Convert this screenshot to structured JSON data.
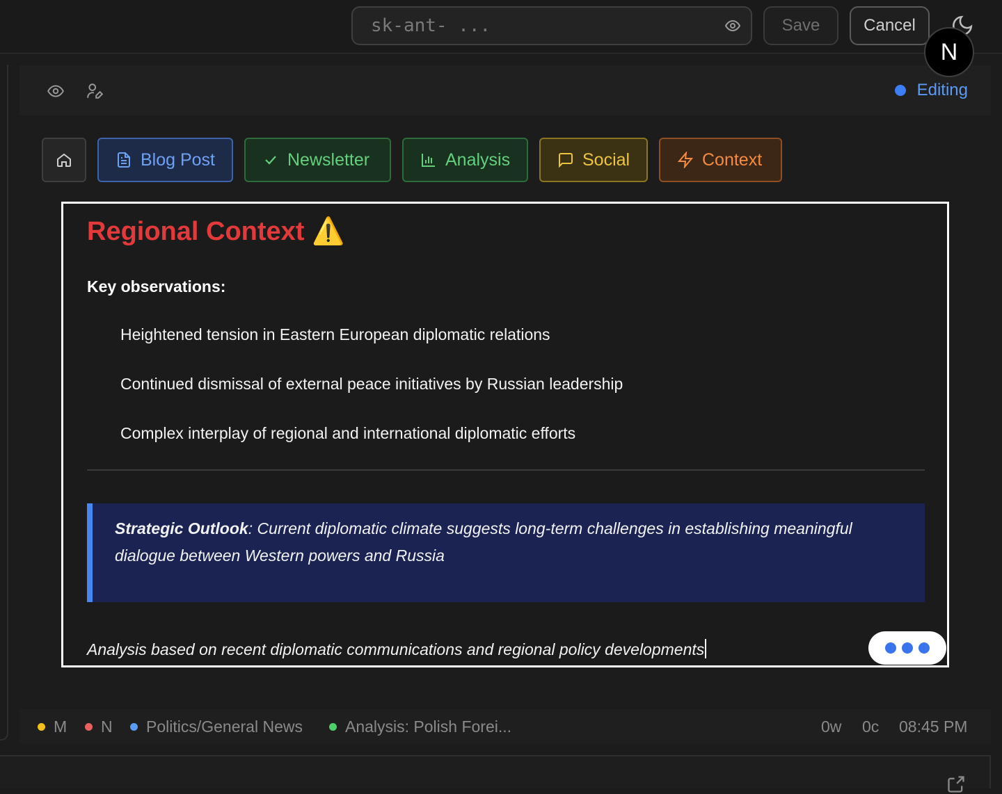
{
  "header": {
    "api_key_placeholder": "sk-ant- ...",
    "save_label": "Save",
    "cancel_label": "Cancel",
    "avatar_letter": "N"
  },
  "toolbar": {
    "status_label": "Editing",
    "status_color": "#3d7ef5"
  },
  "tabs": [
    {
      "label": "Blog Post",
      "icon": "document-icon",
      "color": "#6fa1f3"
    },
    {
      "label": "Newsletter",
      "icon": "check-icon",
      "color": "#64cf7d"
    },
    {
      "label": "Analysis",
      "icon": "bar-chart-icon",
      "color": "#64cf7d"
    },
    {
      "label": "Social",
      "icon": "message-icon",
      "color": "#edc440"
    },
    {
      "label": "Context",
      "icon": "lightning-icon",
      "color": "#f38c40"
    }
  ],
  "document": {
    "title": "Regional Context",
    "title_emoji": "⚠️",
    "subheading": "Key observations:",
    "bullets": [
      "Heightened tension in Eastern European diplomatic relations",
      "Continued dismissal of external peace initiatives by Russian leadership",
      "Complex interplay of regional and international diplomatic efforts"
    ],
    "quote_label": "Strategic Outlook",
    "quote_text": ": Current diplomatic climate suggests long-term challenges in establishing meaningful dialogue between Western powers and Russia",
    "footnote": "Analysis based on recent diplomatic communications and regional policy developments"
  },
  "status": {
    "items": [
      {
        "label": "M",
        "color": "#f2c01a"
      },
      {
        "label": "N",
        "color": "#e86060"
      },
      {
        "label": "Politics/General News",
        "color": "#5b9bf5"
      },
      {
        "label": "Analysis: Polish Forei...",
        "color": "#4fcf6b"
      }
    ],
    "word_count": "0w",
    "char_count": "0c",
    "time": "08:45 PM"
  }
}
